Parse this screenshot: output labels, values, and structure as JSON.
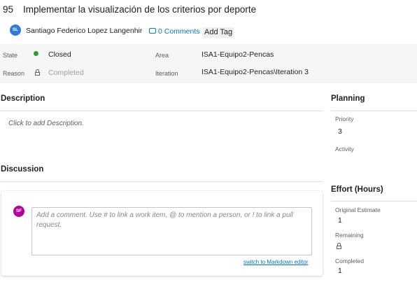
{
  "work_item": {
    "id": "95",
    "title": "Implementar la visualización de los criterios por deporte",
    "owner_initials": "SL",
    "owner_name": "Santiago Federico Lopez Langenhir",
    "comments_label": "0 Comments",
    "add_tag_label": "Add Tag"
  },
  "fields": {
    "state_label": "State",
    "state_value": "Closed",
    "state_color": "#339933",
    "reason_label": "Reason",
    "reason_value": "Completed",
    "area_label": "Area",
    "area_value": "ISA1-Equipo2-Pencas",
    "iteration_label": "Iteration",
    "iteration_value": "ISA1-Equipo2-Pencas\\Iteration 3"
  },
  "description": {
    "title": "Description",
    "placeholder": "Click to add Description."
  },
  "discussion": {
    "title": "Discussion",
    "user_initials": "SF",
    "comment_placeholder": "Add a comment. Use # to link a work item, @ to mention a person, or ! to link a pull request.",
    "markdown_link": "switch to Markdown editor"
  },
  "planning": {
    "title": "Planning",
    "priority_label": "Priority",
    "priority_value": "3",
    "activity_label": "Activity"
  },
  "effort": {
    "title": "Effort (Hours)",
    "original_estimate_label": "Original Estimate",
    "original_estimate_value": "1",
    "remaining_label": "Remaining",
    "completed_label": "Completed",
    "completed_value": "1"
  },
  "colors": {
    "accent": "#0078d4",
    "avatar_owner": "#2f7bd6",
    "avatar_commenter": "#b4009e"
  },
  "icons": [
    "comment-icon",
    "lock-icon",
    "state-dot-icon"
  ]
}
